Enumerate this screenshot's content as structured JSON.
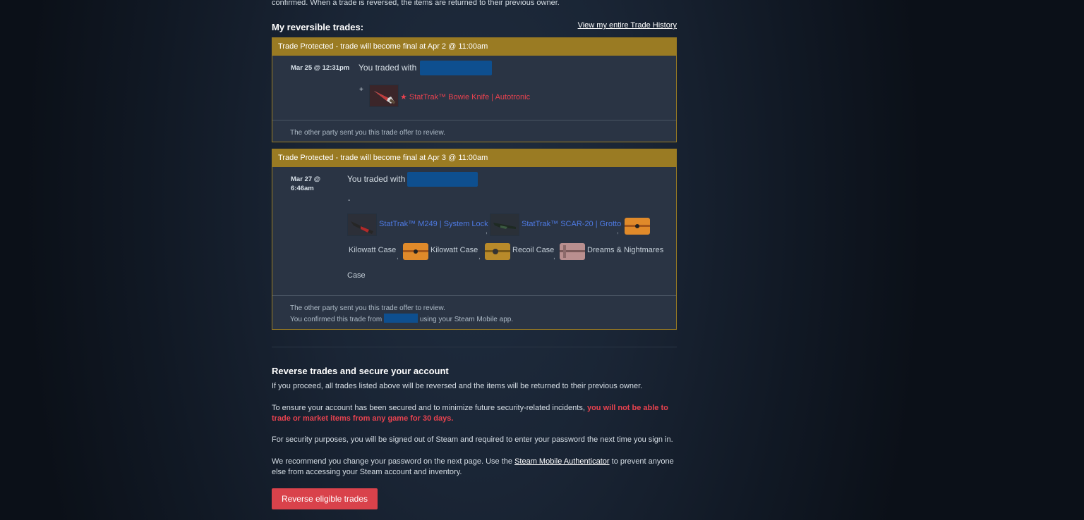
{
  "intro_text": "confirmed. When a trade is reversed, the items are returned to their previous owner.",
  "section": {
    "title": "My reversible trades:",
    "history_link": "View my entire Trade History"
  },
  "trades": [
    {
      "banner": "Trade Protected - trade will become final at Apr 2 @ 11:00am",
      "date": "Mar 25 @ 12:31pm",
      "traded_with_label": "You traded with",
      "direction": "+",
      "items": [
        {
          "name": "★ StatTrak™ Bowie Knife | Autotronic",
          "icon": "knife-icon"
        }
      ],
      "footer": [
        "The other party sent you this trade offer to review."
      ]
    },
    {
      "banner": "Trade Protected - trade will become final at Apr 3 @ 11:00am",
      "date_line1": "Mar 27 @",
      "date_line2": "6:46am",
      "traded_with_label": "You traded with",
      "direction": "-",
      "items": [
        {
          "name": "StatTrak™ M249 | System Lock",
          "icon": "m249-icon"
        },
        {
          "name": "StatTrak™ SCAR-20 | Grotto",
          "icon": "scar20-icon"
        },
        {
          "name": "Kilowatt Case",
          "icon": "kilowatt-case-icon"
        },
        {
          "name": "Kilowatt Case",
          "icon": "kilowatt-case-icon"
        },
        {
          "name": "Recoil Case",
          "icon": "recoil-case-icon"
        },
        {
          "name": "Dreams & Nightmares",
          "icon": "dreams-nightmares-case-icon"
        },
        {
          "name": "Case",
          "icon": ""
        }
      ],
      "footer": [
        "The other party sent you this trade offer to review.",
        "You confirmed this trade from",
        "using your Steam Mobile app."
      ]
    }
  ],
  "reverse": {
    "title": "Reverse trades and secure your account",
    "p1": "If you proceed, all trades listed above will be reversed and the items will be returned to their previous owner.",
    "p2_normal": "To ensure your account has been secured and to minimize future security-related incidents, ",
    "p2_warn1": "you will not be able to",
    "p2_warn2": "trade or market items from any game for 30 days.",
    "p3": "For security purposes, you will be signed out of Steam and required to enter your password the next time you sign in.",
    "p4_a": "We recommend you change your password on the next page. Use the ",
    "p4_link": "Steam Mobile Authenticator",
    "p4_b": " to prevent anyone",
    "p4_c": "else from accessing your Steam account and inventory.",
    "button": "Reverse eligible trades"
  },
  "colors": {
    "banner": "#9a7b23",
    "warning_red": "#e8424f",
    "stattrak_blue": "#4e7ae3",
    "button": "#d9424b"
  }
}
